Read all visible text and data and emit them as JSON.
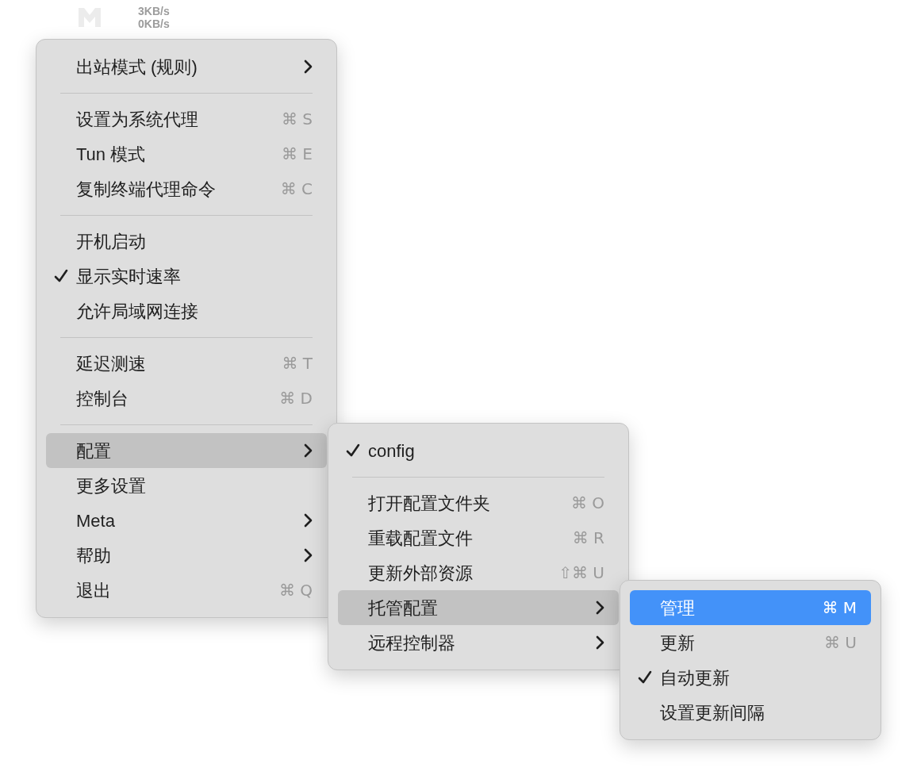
{
  "menu_bar": {
    "upload_speed": "3KB/s",
    "download_speed": "0KB/s"
  },
  "menus": [
    {
      "items": [
        {
          "kind": "item",
          "label": "出站模式 (规则)",
          "submenu": true,
          "checked": false,
          "expanded": false,
          "selected": false
        },
        {
          "kind": "separator"
        },
        {
          "kind": "item",
          "label": "设置为系统代理",
          "shortcut": "⌘ S",
          "submenu": false,
          "checked": false,
          "expanded": false,
          "selected": false
        },
        {
          "kind": "item",
          "label": "Tun 模式",
          "shortcut": "⌘ E",
          "submenu": false,
          "checked": false,
          "expanded": false,
          "selected": false
        },
        {
          "kind": "item",
          "label": "复制终端代理命令",
          "shortcut": "⌘ C",
          "submenu": false,
          "checked": false,
          "expanded": false,
          "selected": false
        },
        {
          "kind": "separator"
        },
        {
          "kind": "item",
          "label": "开机启动",
          "submenu": false,
          "checked": false,
          "expanded": false,
          "selected": false
        },
        {
          "kind": "item",
          "label": "显示实时速率",
          "submenu": false,
          "checked": true,
          "expanded": false,
          "selected": false
        },
        {
          "kind": "item",
          "label": "允许局域网连接",
          "submenu": false,
          "checked": false,
          "expanded": false,
          "selected": false
        },
        {
          "kind": "separator"
        },
        {
          "kind": "item",
          "label": "延迟测速",
          "shortcut": "⌘ T",
          "submenu": false,
          "checked": false,
          "expanded": false,
          "selected": false
        },
        {
          "kind": "item",
          "label": "控制台",
          "shortcut": "⌘ D",
          "submenu": false,
          "checked": false,
          "expanded": false,
          "selected": false
        },
        {
          "kind": "separator"
        },
        {
          "kind": "item",
          "label": "配置",
          "submenu": true,
          "checked": false,
          "expanded": true,
          "selected": false
        },
        {
          "kind": "item",
          "label": "更多设置",
          "submenu": false,
          "checked": false,
          "expanded": false,
          "selected": false
        },
        {
          "kind": "item",
          "label": "Meta",
          "submenu": true,
          "checked": false,
          "expanded": false,
          "selected": false
        },
        {
          "kind": "item",
          "label": "帮助",
          "submenu": true,
          "checked": false,
          "expanded": false,
          "selected": false
        },
        {
          "kind": "item",
          "label": "退出",
          "shortcut": "⌘ Q",
          "submenu": false,
          "checked": false,
          "expanded": false,
          "selected": false
        }
      ]
    },
    {
      "items": [
        {
          "kind": "item",
          "label": "config",
          "submenu": false,
          "checked": true,
          "expanded": false,
          "selected": false
        },
        {
          "kind": "separator"
        },
        {
          "kind": "item",
          "label": "打开配置文件夹",
          "shortcut": "⌘ O",
          "submenu": false,
          "checked": false,
          "expanded": false,
          "selected": false
        },
        {
          "kind": "item",
          "label": "重载配置文件",
          "shortcut": "⌘ R",
          "submenu": false,
          "checked": false,
          "expanded": false,
          "selected": false
        },
        {
          "kind": "item",
          "label": "更新外部资源",
          "shortcut": "⇧⌘ U",
          "submenu": false,
          "checked": false,
          "expanded": false,
          "selected": false
        },
        {
          "kind": "item",
          "label": "托管配置",
          "submenu": true,
          "checked": false,
          "expanded": true,
          "selected": false
        },
        {
          "kind": "item",
          "label": "远程控制器",
          "submenu": true,
          "checked": false,
          "expanded": false,
          "selected": false
        }
      ]
    },
    {
      "items": [
        {
          "kind": "item",
          "label": "管理",
          "shortcut": "⌘ M",
          "submenu": false,
          "checked": false,
          "expanded": false,
          "selected": true
        },
        {
          "kind": "item",
          "label": "更新",
          "shortcut": "⌘ U",
          "submenu": false,
          "checked": false,
          "expanded": false,
          "selected": false
        },
        {
          "kind": "item",
          "label": "自动更新",
          "submenu": false,
          "checked": true,
          "expanded": false,
          "selected": false
        },
        {
          "kind": "item",
          "label": "设置更新间隔",
          "submenu": false,
          "checked": false,
          "expanded": false,
          "selected": false
        }
      ]
    }
  ]
}
